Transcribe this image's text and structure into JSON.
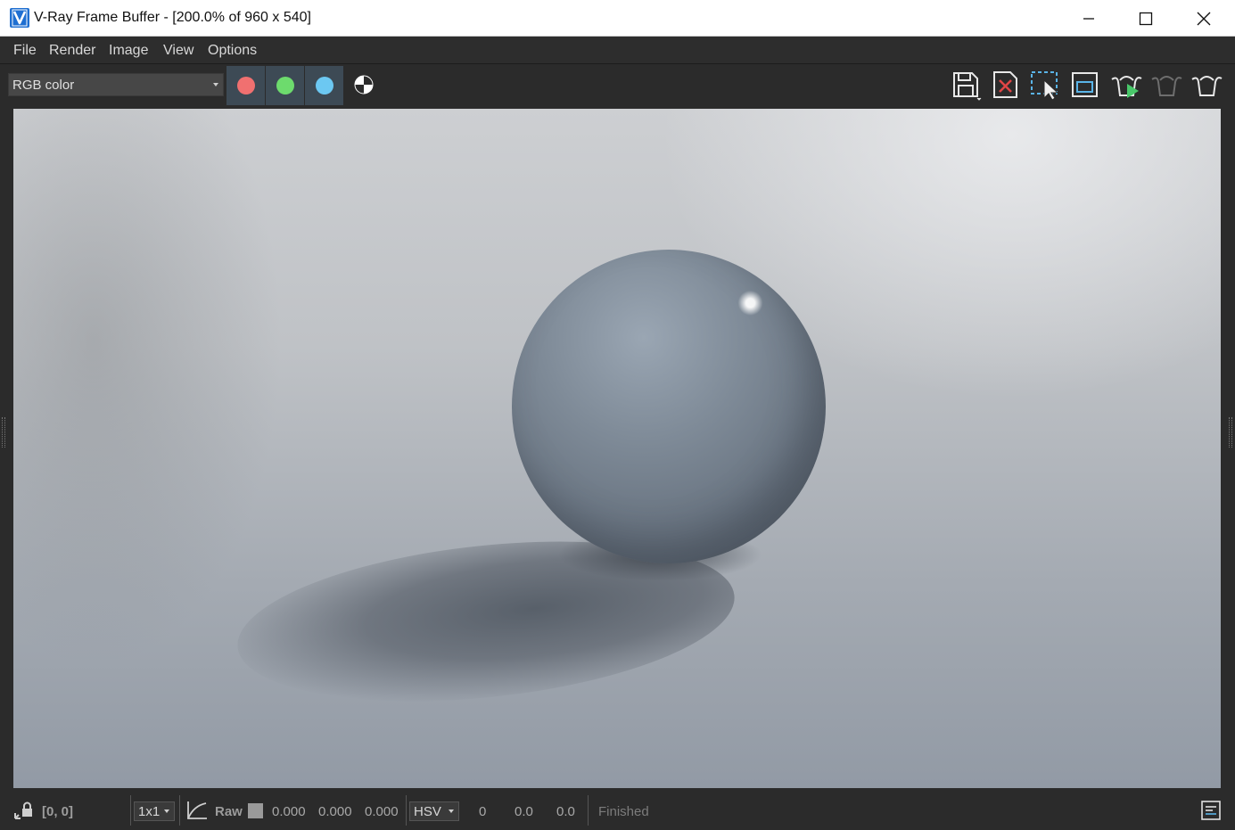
{
  "window": {
    "title": "V-Ray Frame Buffer - [200.0% of 960 x 540]",
    "app_icon": "vray-logo-icon",
    "controls": [
      "minimize-icon",
      "maximize-icon",
      "close-icon"
    ]
  },
  "menu": {
    "items": [
      "File",
      "Render",
      "Image",
      "View",
      "Options"
    ]
  },
  "toolbar": {
    "channel": "RGB color",
    "channel_buttons": [
      {
        "name": "red-channel-button",
        "color": "#f07070"
      },
      {
        "name": "green-channel-button",
        "color": "#6ddb6d"
      },
      {
        "name": "blue-channel-button",
        "color": "#6cc8f2"
      }
    ],
    "right_icons": [
      "save-image-icon",
      "clear-image-icon",
      "region-render-icon",
      "follow-mouse-icon",
      "render-icon",
      "stop-render-icon",
      "render-last-icon"
    ]
  },
  "status": {
    "coords": "[0, 0]",
    "sample_size": "1x1",
    "raw_label": "Raw",
    "raw_values": [
      "0.000",
      "0.000",
      "0.000"
    ],
    "color_mode": "HSV",
    "hsv_values": [
      "0",
      "0.0",
      "0.0"
    ],
    "state": "Finished"
  }
}
